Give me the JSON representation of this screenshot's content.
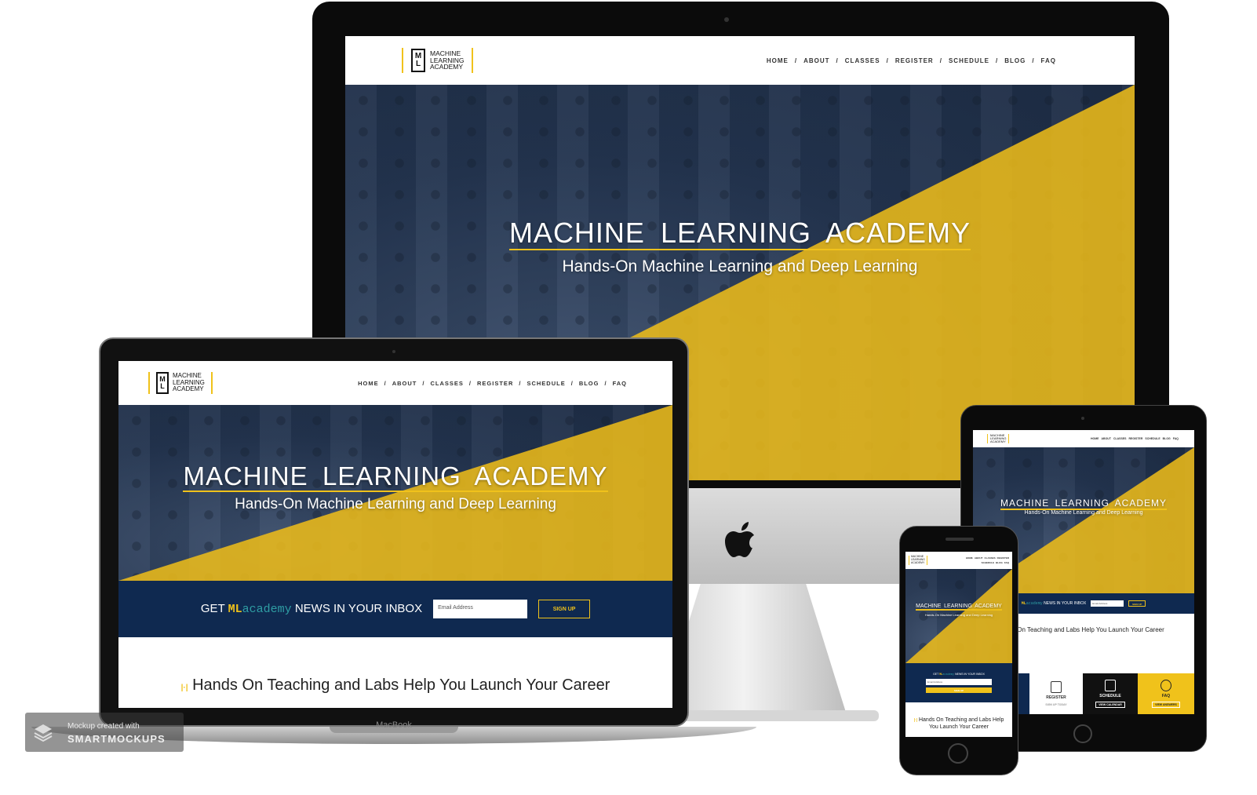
{
  "site": {
    "logo_lines": [
      "MACHINE",
      "LEARNING",
      "ACADEMY"
    ],
    "logo_initials": [
      "M",
      "L"
    ],
    "menu": [
      "HOME",
      "ABOUT",
      "CLASSES",
      "REGISTER",
      "SCHEDULE",
      "BLOG",
      "FAQ"
    ],
    "menu_sep": "/",
    "hero_title": "MACHINE LEARNING ACADEMY",
    "hero_subtitle": "Hands-On Machine Learning and Deep Learning",
    "newsletter_prefix": "GET",
    "newsletter_ml": "ML",
    "newsletter_academy": "academy",
    "newsletter_suffix": "NEWS IN YOUR INBOX",
    "email_placeholder": "Email Address",
    "signup_label": "SIGN UP",
    "section_heading": "Hands On Teaching and Labs Help You Launch Your Career",
    "section_heading_short": "s On Teaching and Labs Help You Launch Your Career",
    "tiles": [
      {
        "label": "REGISTER",
        "cta": "SIGN UP TODAY"
      },
      {
        "label": "SCHEDULE",
        "cta": "VIEW CALENDAR"
      },
      {
        "label": "FAQ",
        "cta": "VIEW ANSWERS"
      }
    ]
  },
  "devices": {
    "laptop_brand": "MacBook"
  },
  "watermark": {
    "line1": "Mockup created with",
    "line2": "SMARTMOCKUPS"
  },
  "colors": {
    "brand_yellow": "#f0c21b",
    "brand_navy": "#0f2950",
    "teal": "#2f9ea4"
  }
}
